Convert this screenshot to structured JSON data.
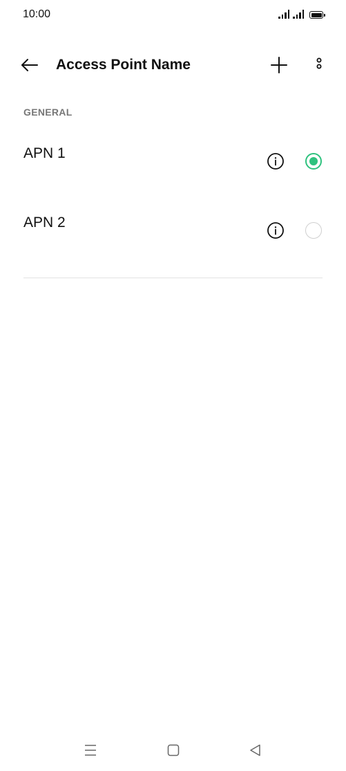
{
  "status_bar": {
    "time": "10:00",
    "icons": [
      "signal-icon",
      "signal-icon",
      "battery-icon"
    ]
  },
  "app_bar": {
    "back_icon": "arrow-left-icon",
    "title": "Access Point Name",
    "add_icon": "plus-icon",
    "more_icon": "more-vertical-icon"
  },
  "section": {
    "header": "GENERAL"
  },
  "apns": [
    {
      "name": "APN 1",
      "selected": true,
      "info_icon": "info-icon"
    },
    {
      "name": "APN 2",
      "selected": false,
      "info_icon": "info-icon"
    }
  ],
  "colors": {
    "accent": "#2ec27e",
    "text": "#111111",
    "section_header": "#777777",
    "divider": "#e3e3e3"
  },
  "nav_bar": {
    "icons": [
      "menu-icon",
      "home-square-icon",
      "back-triangle-icon"
    ]
  }
}
